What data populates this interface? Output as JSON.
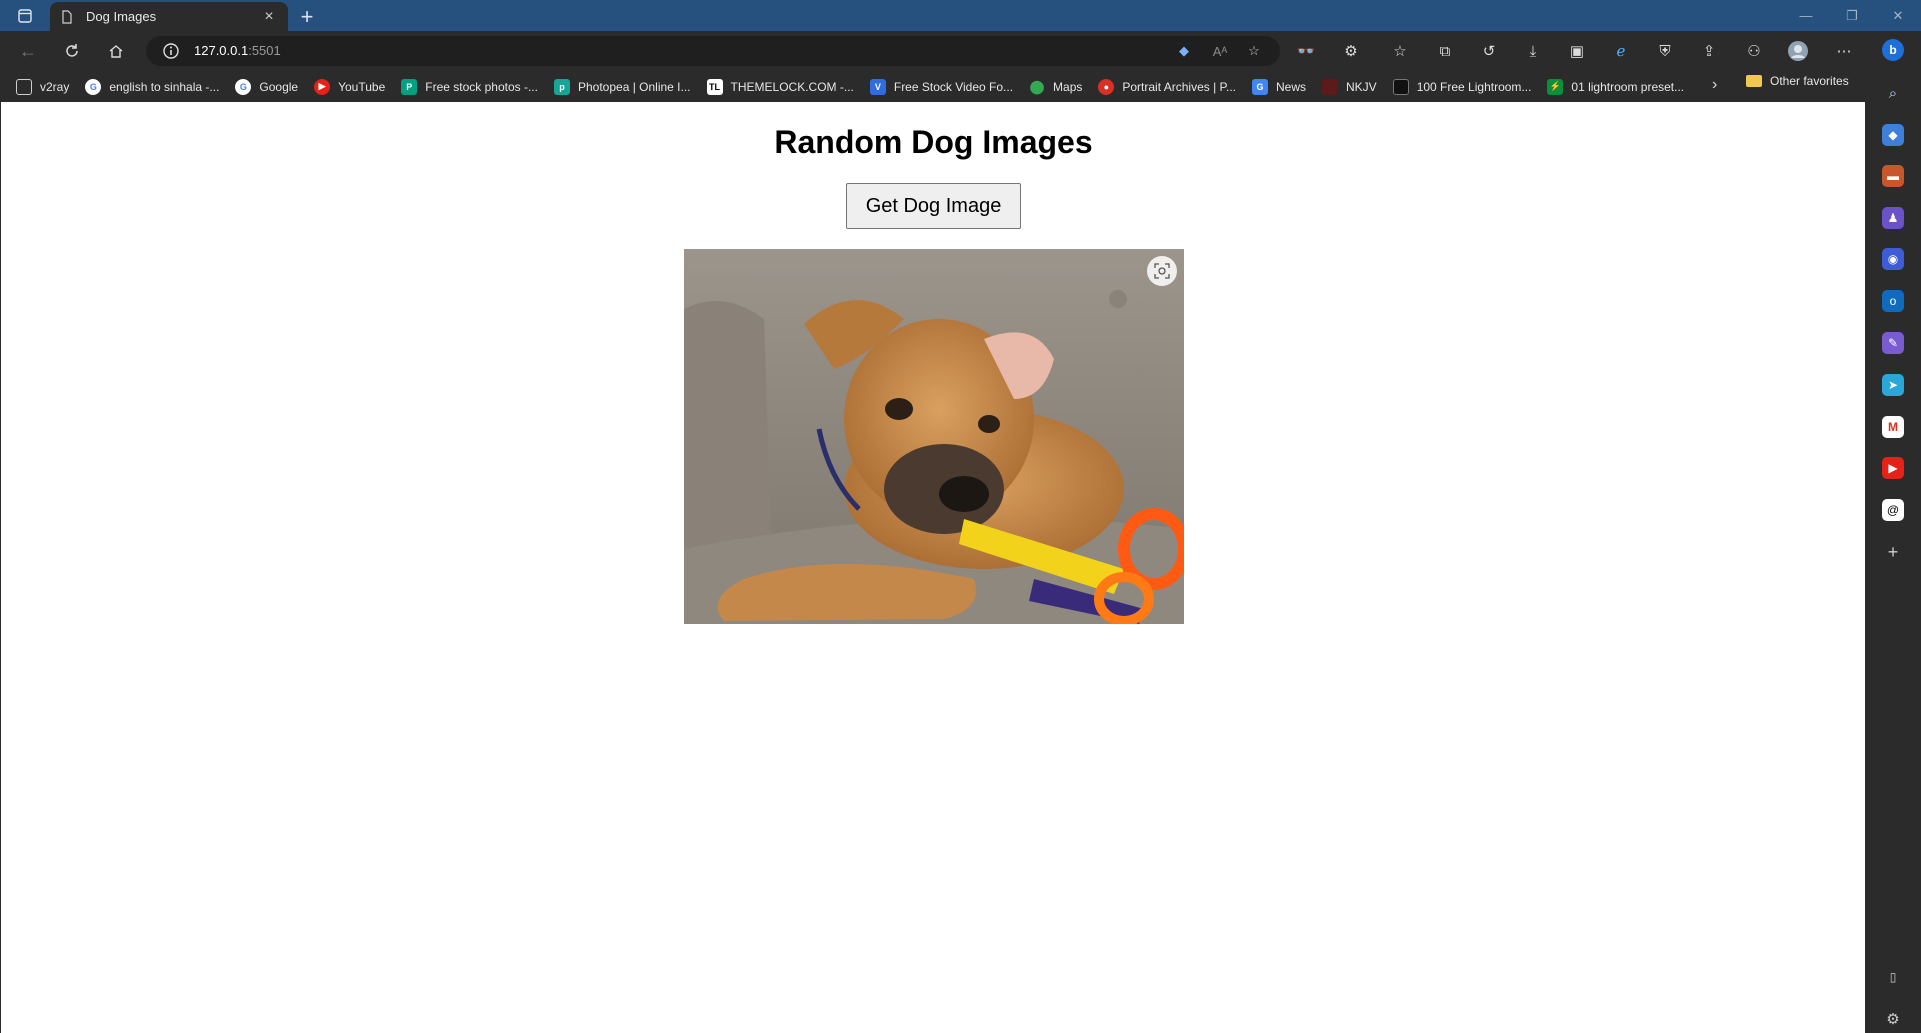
{
  "tab": {
    "title": "Dog Images"
  },
  "address": {
    "host": "127.0.0.1",
    "port": ":5501"
  },
  "favorites": [
    {
      "label": "v2ray",
      "icon": "page-icon",
      "color": "#3a3a3a"
    },
    {
      "label": "english to sinhala -...",
      "icon": "google-icon",
      "color": "#ffffff"
    },
    {
      "label": "Google",
      "icon": "google-icon",
      "color": "#ffffff"
    },
    {
      "label": "YouTube",
      "icon": "youtube-icon",
      "color": "#e62117"
    },
    {
      "label": "Free stock photos -...",
      "icon": "pexels-icon",
      "color": "#05a081"
    },
    {
      "label": "Photopea | Online I...",
      "icon": "photopea-icon",
      "color": "#18a497"
    },
    {
      "label": "THEMELOCK.COM -...",
      "icon": "themelock-icon",
      "color": "#000000"
    },
    {
      "label": "Free Stock Video Fo...",
      "icon": "videvo-icon",
      "color": "#2f6de1"
    },
    {
      "label": "Maps",
      "icon": "maps-icon",
      "color": "#34a853"
    },
    {
      "label": "Portrait Archives | P...",
      "icon": "portrait-icon",
      "color": "#d93025"
    },
    {
      "label": "News",
      "icon": "news-icon",
      "color": "#4285f4"
    },
    {
      "label": "NKJV",
      "icon": "nkjv-icon",
      "color": "#5c1a1a"
    },
    {
      "label": "100 Free Lightroom...",
      "icon": "lightroom-icon",
      "color": "#111111"
    },
    {
      "label": "01 lightroom preset...",
      "icon": "preset-icon",
      "color": "#0a8f3a"
    }
  ],
  "favorites_other": "Other favorites",
  "page": {
    "heading": "Random Dog Images",
    "button_label": "Get Dog Image"
  },
  "colors": {
    "titlebar": "#26507e",
    "chrome": "#2b2b2b",
    "page_bg": "#ffffff"
  }
}
